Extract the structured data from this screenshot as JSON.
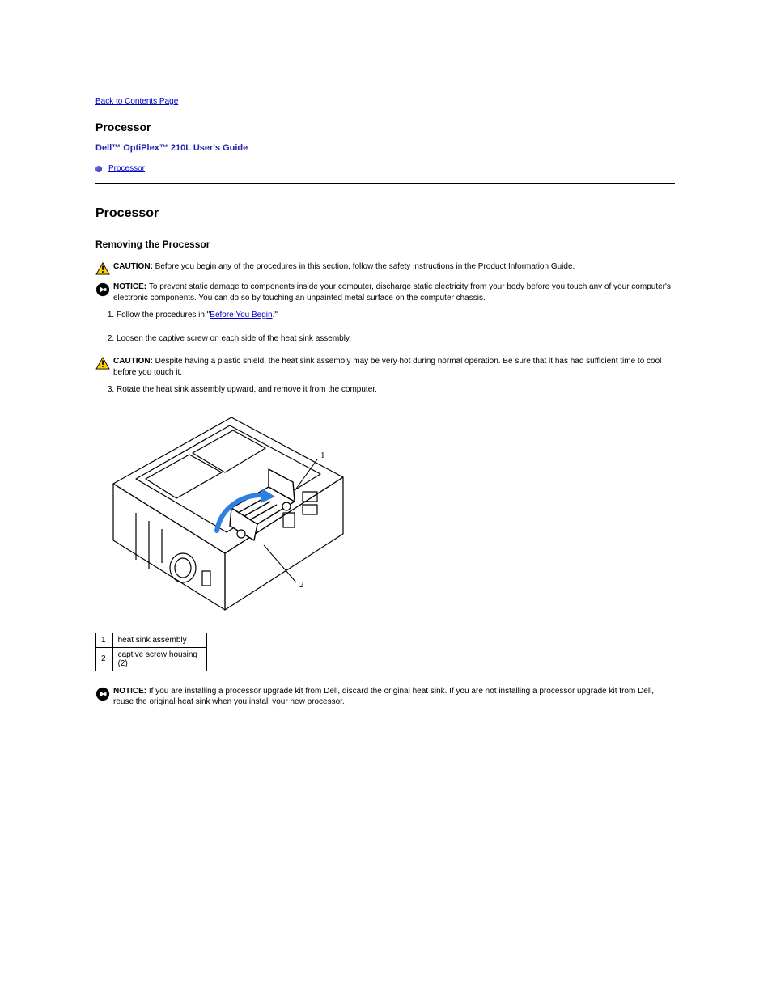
{
  "nav": {
    "back": "Back to Contents Page"
  },
  "header": {
    "section": "Processor",
    "guide_title": "Dell™ OptiPlex™ 210L User's Guide"
  },
  "toc": {
    "item1": "Processor"
  },
  "proc": {
    "heading": "Processor",
    "removing_heading": "Removing the Processor",
    "caution1_label": "CAUTION: ",
    "caution1_text": "Before you begin any of the procedures in this section, follow the safety instructions in the Product Information Guide.",
    "notice1_label": "NOTICE: ",
    "notice1_text": "To prevent static damage to components inside your computer, discharge static electricity from your body before you touch any of your computer's electronic components. You can do so by touching an unpainted metal surface on the computer chassis.",
    "step1": "Follow the procedures in \"",
    "step1_link": "Before You Begin",
    "step1_tail": ".\"",
    "step2": "Loosen the captive screw on each side of the heat sink assembly.",
    "caution2_label": "CAUTION: ",
    "caution2_text": "Despite having a plastic shield, the heat sink assembly may be very hot during normal operation. Be sure that it has had sufficient time to cool before you touch it.",
    "step3": "Rotate the heat sink assembly upward, and remove it from the computer.",
    "labels": {
      "r1n": "1",
      "r1t": "heat sink assembly",
      "r2n": "2",
      "r2t": "captive screw housing (2)"
    },
    "notice2_label": "NOTICE: ",
    "notice2_text": "If you are installing a processor upgrade kit from Dell, discard the original heat sink. If you are not installing a processor upgrade kit from Dell, reuse the original heat sink when you install your new processor."
  }
}
